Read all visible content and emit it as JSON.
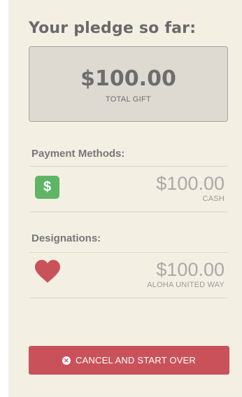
{
  "header": {
    "title": "Your pledge so far:"
  },
  "total": {
    "amount": "$100.00",
    "label": "TOTAL GIFT"
  },
  "payment_methods": {
    "heading": "Payment Methods:",
    "items": [
      {
        "icon": "dollar-icon",
        "icon_glyph": "$",
        "amount": "$100.00",
        "label": "CASH"
      }
    ]
  },
  "designations": {
    "heading": "Designations:",
    "items": [
      {
        "icon": "heart-icon",
        "amount": "$100.00",
        "label": "ALOHA UNITED WAY"
      }
    ]
  },
  "actions": {
    "cancel_label": "CANCEL AND START OVER"
  },
  "colors": {
    "background": "#f4efe3",
    "total_box": "#dedad2",
    "cash_icon": "#5fb566",
    "heart_icon": "#c9525a",
    "cancel_button": "#c9525a"
  }
}
